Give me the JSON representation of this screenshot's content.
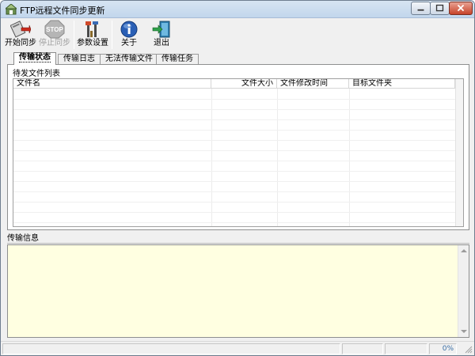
{
  "window": {
    "title": "FTP远程文件同步更新"
  },
  "toolbar": {
    "start_label": "开始同步",
    "stop_label": "停止同步",
    "settings_label": "参数设置",
    "about_label": "关于",
    "exit_label": "退出"
  },
  "tabs": [
    {
      "label": "传输状态",
      "active": true
    },
    {
      "label": "传输日志",
      "active": false
    },
    {
      "label": "无法传输文件",
      "active": false
    },
    {
      "label": "传输任务",
      "active": false
    }
  ],
  "pending": {
    "group_title": "待发文件列表",
    "columns": [
      "文件名",
      "文件大小",
      "文件修改时间",
      "目标文件夹"
    ]
  },
  "info": {
    "title": "传输信息",
    "background": "#ffffe1"
  },
  "statusbar": {
    "progress_text": "0%"
  },
  "icons": {
    "app": "ftp-app-icon",
    "start": "start-sync-icon",
    "stop": "stop-sign-icon",
    "settings": "tools-icon",
    "about": "info-icon",
    "exit": "exit-door-icon"
  }
}
